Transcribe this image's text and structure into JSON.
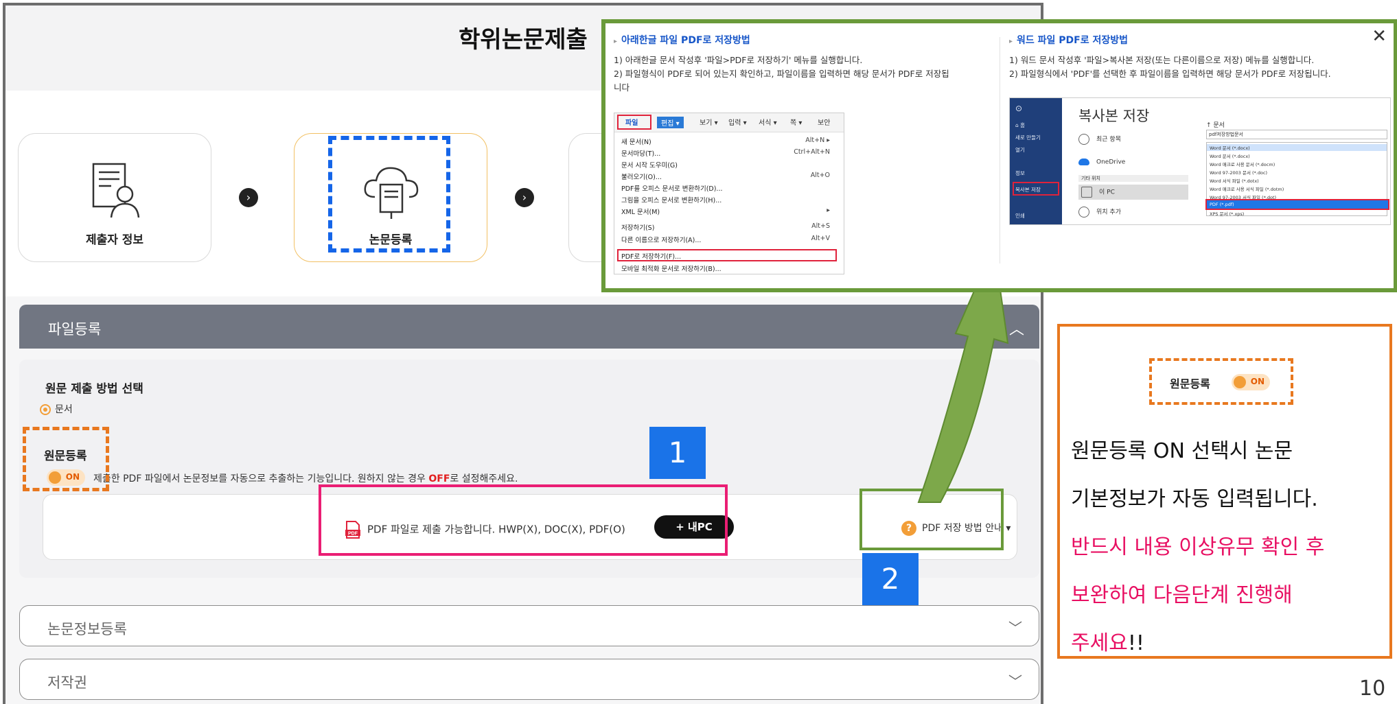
{
  "page": {
    "title": "학위논문제출",
    "page_number": "10"
  },
  "steps": [
    {
      "label": "제출자 정보",
      "icon": "person-document-icon",
      "active": false
    },
    {
      "label": "논문등록",
      "icon": "cloud-book-icon",
      "active": true
    }
  ],
  "file_section": {
    "title": "파일등록",
    "method_title": "원문 제출 방법 선택",
    "method_option": "문서",
    "orig_label": "원문등록",
    "toggle_on": "ON",
    "desc_before": "제출한 PDF 파일에서 논문정보를 자동으로 추출하는 기능입니다. 원하지 않는 경우 ",
    "desc_highlight": "OFF",
    "desc_after": "로 설정해주세요.",
    "upload_text": "PDF 파일로 제출 가능합니다. HWP(X), DOC(X), PDF(O)",
    "mypc_button": "+ 내PC",
    "pdf_guide": "PDF 저장 방법 안내 ▾"
  },
  "accordions": [
    {
      "title": "논문정보등록"
    },
    {
      "title": "저작권"
    }
  ],
  "annotations": {
    "num1": "1",
    "num2": "2"
  },
  "popup": {
    "hwp": {
      "title": "아래한글 파일 PDF로 저장방법",
      "line1": "1) 아래한글 문서 작성후 '파일>PDF로 저장하기' 메뉴를 실행합니다.",
      "line2": "2) 파일형식이 PDF로 되어 있는지 확인하고, 파일이름을 입력하면 해당 문서가 PDF로 저장됩",
      "line3": "니다",
      "tabs": [
        "파일",
        "편집 ▾",
        "보기 ▾",
        "입력 ▾",
        "서식 ▾",
        "쪽 ▾",
        "보안"
      ],
      "menu": [
        {
          "label": "새 문서(N)",
          "shortcut": "Alt+N ▸"
        },
        {
          "label": "문서마당(T)...",
          "shortcut": "Ctrl+Alt+N"
        },
        {
          "label": "문서 시작 도우미(G)",
          "shortcut": ""
        },
        {
          "label": "불러오기(O)...",
          "shortcut": "Alt+O"
        },
        {
          "label": "PDF를 오피스 문서로 변환하기(D)...",
          "shortcut": ""
        },
        {
          "label": "그림을 오피스 문서로 변환하기(H)...",
          "shortcut": ""
        },
        {
          "label": "XML 문서(M)",
          "shortcut": "▸"
        },
        {
          "label": "저장하기(S)",
          "shortcut": "Alt+S"
        },
        {
          "label": "다른 이름으로 저장하기(A)...",
          "shortcut": "Alt+V"
        },
        {
          "label": "PDF로 저장하기(F)...",
          "shortcut": ""
        },
        {
          "label": "모바일 최적화 문서로 저장하기(B)...",
          "shortcut": ""
        }
      ]
    },
    "word": {
      "title": "워드 파일 PDF로 저장방법",
      "line1": "1) 워드 문서 작성후 '파일>복사본 저장(또는 다른이름으로 저장) 메뉴를 실행합니다.",
      "line2": "2) 파일형식에서 'PDF'를 선택한 후 파일이름을 입력하면 해당 문서가 PDF로 저장됩니다.",
      "heading": "복사본 저장",
      "side": [
        "⊙",
        "⌂ 홈",
        "새로 만들기",
        "열기",
        "정보",
        "복사본 저장",
        "인쇄"
      ],
      "locations": [
        "최근 항목",
        "OneDrive",
        "이 PC",
        "위치 추가"
      ],
      "other_locations": "기타 위치",
      "path": "↑ 문서",
      "filename": "pdf저장방법문서",
      "file_types": [
        "Word 문서 (*.docx)",
        "Word 문서 (*.docx)",
        "Word 매크로 사용 문서 (*.docm)",
        "Word 97-2003 문서 (*.doc)",
        "Word 서식 파일 (*.dotx)",
        "Word 매크로 사용 서식 파일 (*.dotm)",
        "Word 97-2003 서식 파일 (*.dot)",
        "PDF (*.pdf)",
        "XPS 문서 (*.xps)"
      ]
    },
    "close": "✕"
  },
  "info_box": {
    "chip_label": "원문등록",
    "chip_toggle": "ON",
    "line1": "원문등록 ON 선택시 논문",
    "line2": "기본정보가 자동 입력됩니다.",
    "line3": "반드시 내용 이상유무 확인 후",
    "line4": "보완하여 다음단계 진행해",
    "line5": "주세요",
    "line5_tail": "!!"
  },
  "colors": {
    "accent_orange": "#e8781f",
    "accent_blue": "#1565e8",
    "accent_pink": "#ea1e74",
    "accent_green": "#6a9a3a",
    "section_header": "#717682"
  }
}
